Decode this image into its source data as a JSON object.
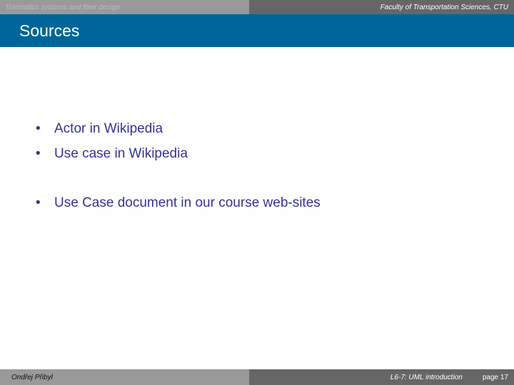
{
  "header": {
    "course": "Telematics systems and their design",
    "faculty": "Faculty of Transportation Sciences, CTU"
  },
  "slide": {
    "title": "Sources",
    "bullets": [
      "Actor in Wikipedia",
      "Use case in Wikipedia",
      "Use Case document in our course web-sites"
    ]
  },
  "footer": {
    "author": "Ondřej Přibyl",
    "lecture": "L6-7: UML introduction",
    "page": "page 17"
  }
}
